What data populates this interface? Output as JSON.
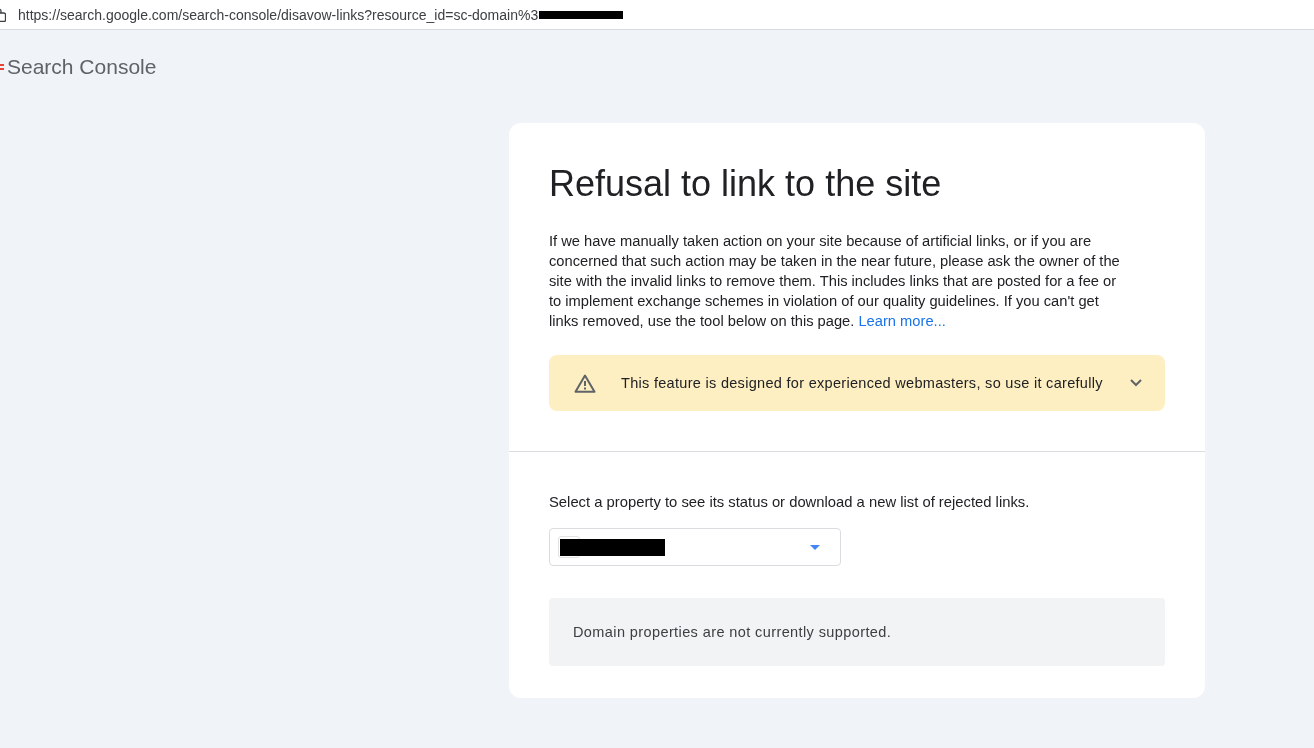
{
  "browser": {
    "url": "https://search.google.com/search-console/disavow-links?resource_id=sc-domain%3",
    "url_redacted": true
  },
  "app": {
    "title": "Search Console"
  },
  "card": {
    "title": "Refusal to link to the site",
    "intro": {
      "text": "If we have manually taken action on your site because of artificial links, or if you are concerned that such action may be taken in the near future, please ask the owner of the site with the invalid links to remove them. This includes links that are posted for a fee or to implement exchange schemes in violation of our quality guidelines. If you can't get links removed, use the tool below on this page.",
      "link": "Learn more..."
    },
    "warning": {
      "text": "This feature is designed for experienced webmasters, so use it carefully",
      "expanded": false
    },
    "property": {
      "label": "Select a property to see its status or download a new list of rejected links.",
      "value_redacted": true
    },
    "notice": {
      "text": "Domain properties are not currently supported."
    }
  }
}
